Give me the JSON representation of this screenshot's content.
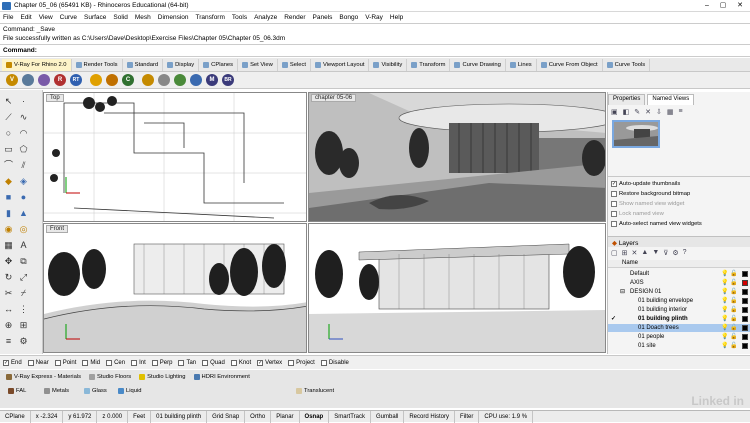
{
  "window": {
    "title": "Chapter 05_06 (65491 KB) - Rhinoceros Educational (64-bit)",
    "minimize": "–",
    "maximize": "▢",
    "close": "✕"
  },
  "menu": [
    "File",
    "Edit",
    "View",
    "Curve",
    "Surface",
    "Solid",
    "Mesh",
    "Dimension",
    "Transform",
    "Tools",
    "Analyze",
    "Render",
    "Panels",
    "Bongo",
    "V-Ray",
    "Help"
  ],
  "command": {
    "line1": "Command: _Save",
    "line2": "File successfully written as C:\\Users\\Dave\\Desktop\\Exercise Files\\Chapter 05\\Chapter 05_06.3dm",
    "prompt": "Command:"
  },
  "tabs": [
    "V-Ray For Rhino 2.0",
    "Render Tools",
    "Standard",
    "Display",
    "CPlanes",
    "Set View",
    "Select",
    "Viewport Layout",
    "Visibility",
    "Transform",
    "Curve Drawing",
    "Lines",
    "Curve From Object",
    "Curve Tools"
  ],
  "iconrow": [
    {
      "label": "V",
      "color": "#c58a00"
    },
    {
      "label": "R",
      "color": "#b03030"
    },
    {
      "label": "RT",
      "color": "#3060b0"
    },
    {
      "label": "C",
      "color": "#307030"
    },
    {
      "label": "M",
      "color": "#3a3a7a"
    },
    {
      "label": "BR",
      "color": "#3a3a7a"
    }
  ],
  "viewports": {
    "top": "Top",
    "persp": "chapter 05-06",
    "front": "Front",
    "right": ""
  },
  "panel": {
    "tab1": "Properties",
    "tab2": "Named Views",
    "options": [
      {
        "label": "Auto-update thumbnails",
        "checked": true,
        "disabled": false
      },
      {
        "label": "Restore background bitmap",
        "checked": false,
        "disabled": false
      },
      {
        "label": "Show named view widget",
        "checked": false,
        "disabled": true
      },
      {
        "label": "Lock named view",
        "checked": false,
        "disabled": true
      },
      {
        "label": "Auto-select named view widgets",
        "checked": false,
        "disabled": false
      }
    ],
    "layers_title": "Layers",
    "layers_header": "Name",
    "layers": [
      {
        "name": "Default",
        "color": "#000000",
        "bold": false,
        "current": false,
        "selected": false,
        "indent": 0
      },
      {
        "name": "AXIS",
        "color": "#d00000",
        "bold": false,
        "current": false,
        "selected": false,
        "indent": 0
      },
      {
        "name": "DESIGN 01",
        "color": "#000000",
        "bold": false,
        "current": false,
        "selected": false,
        "indent": 0,
        "prefix": "⊟"
      },
      {
        "name": "01 building envelope",
        "color": "#000000",
        "bold": false,
        "current": false,
        "selected": false,
        "indent": 1
      },
      {
        "name": "01 building interior",
        "color": "#000000",
        "bold": false,
        "current": false,
        "selected": false,
        "indent": 1
      },
      {
        "name": "01 building plinth",
        "color": "#000000",
        "bold": true,
        "current": true,
        "selected": false,
        "indent": 1
      },
      {
        "name": "01 Doach trees",
        "color": "#000000",
        "bold": false,
        "current": false,
        "selected": true,
        "indent": 1
      },
      {
        "name": "01 people",
        "color": "#000000",
        "bold": false,
        "current": false,
        "selected": false,
        "indent": 1
      },
      {
        "name": "01 site",
        "color": "#000000",
        "bold": false,
        "current": false,
        "selected": false,
        "indent": 1
      }
    ]
  },
  "osnap": [
    {
      "label": "End",
      "checked": true
    },
    {
      "label": "Near",
      "checked": false
    },
    {
      "label": "Point",
      "checked": false
    },
    {
      "label": "Mid",
      "checked": false
    },
    {
      "label": "Cen",
      "checked": false
    },
    {
      "label": "Int",
      "checked": false
    },
    {
      "label": "Perp",
      "checked": false
    },
    {
      "label": "Tan",
      "checked": false
    },
    {
      "label": "Quad",
      "checked": false
    },
    {
      "label": "Knot",
      "checked": false
    },
    {
      "label": "Vertex",
      "checked": true
    },
    {
      "label": "Project",
      "checked": false
    },
    {
      "label": "Disable",
      "checked": false
    }
  ],
  "materials_tabs": [
    "V-Ray Express - Materials",
    "Studio Floors",
    "Studio Lighting",
    "HDRI Environment"
  ],
  "materials": [
    "FAL",
    "Metals",
    "Glass",
    "Liquid",
    "Translucent"
  ],
  "status": [
    {
      "text": "CPlane"
    },
    {
      "text": "x -2.324"
    },
    {
      "text": "y 61.972"
    },
    {
      "text": "z 0.000"
    },
    {
      "text": "Feet"
    },
    {
      "text": "01 building plinth"
    },
    {
      "text": "Grid Snap"
    },
    {
      "text": "Ortho"
    },
    {
      "text": "Planar"
    },
    {
      "text": "Osnap",
      "bold": true
    },
    {
      "text": "SmartTrack"
    },
    {
      "text": "Gumball"
    },
    {
      "text": "Record History"
    },
    {
      "text": "Filter"
    },
    {
      "text": "CPU use: 1.9 %"
    }
  ],
  "brand": "Linked in",
  "colors": {
    "selection": "#a9c9ee",
    "panel_bg": "#f4f4f4",
    "toolbar_bg": "#e9e9e9"
  }
}
